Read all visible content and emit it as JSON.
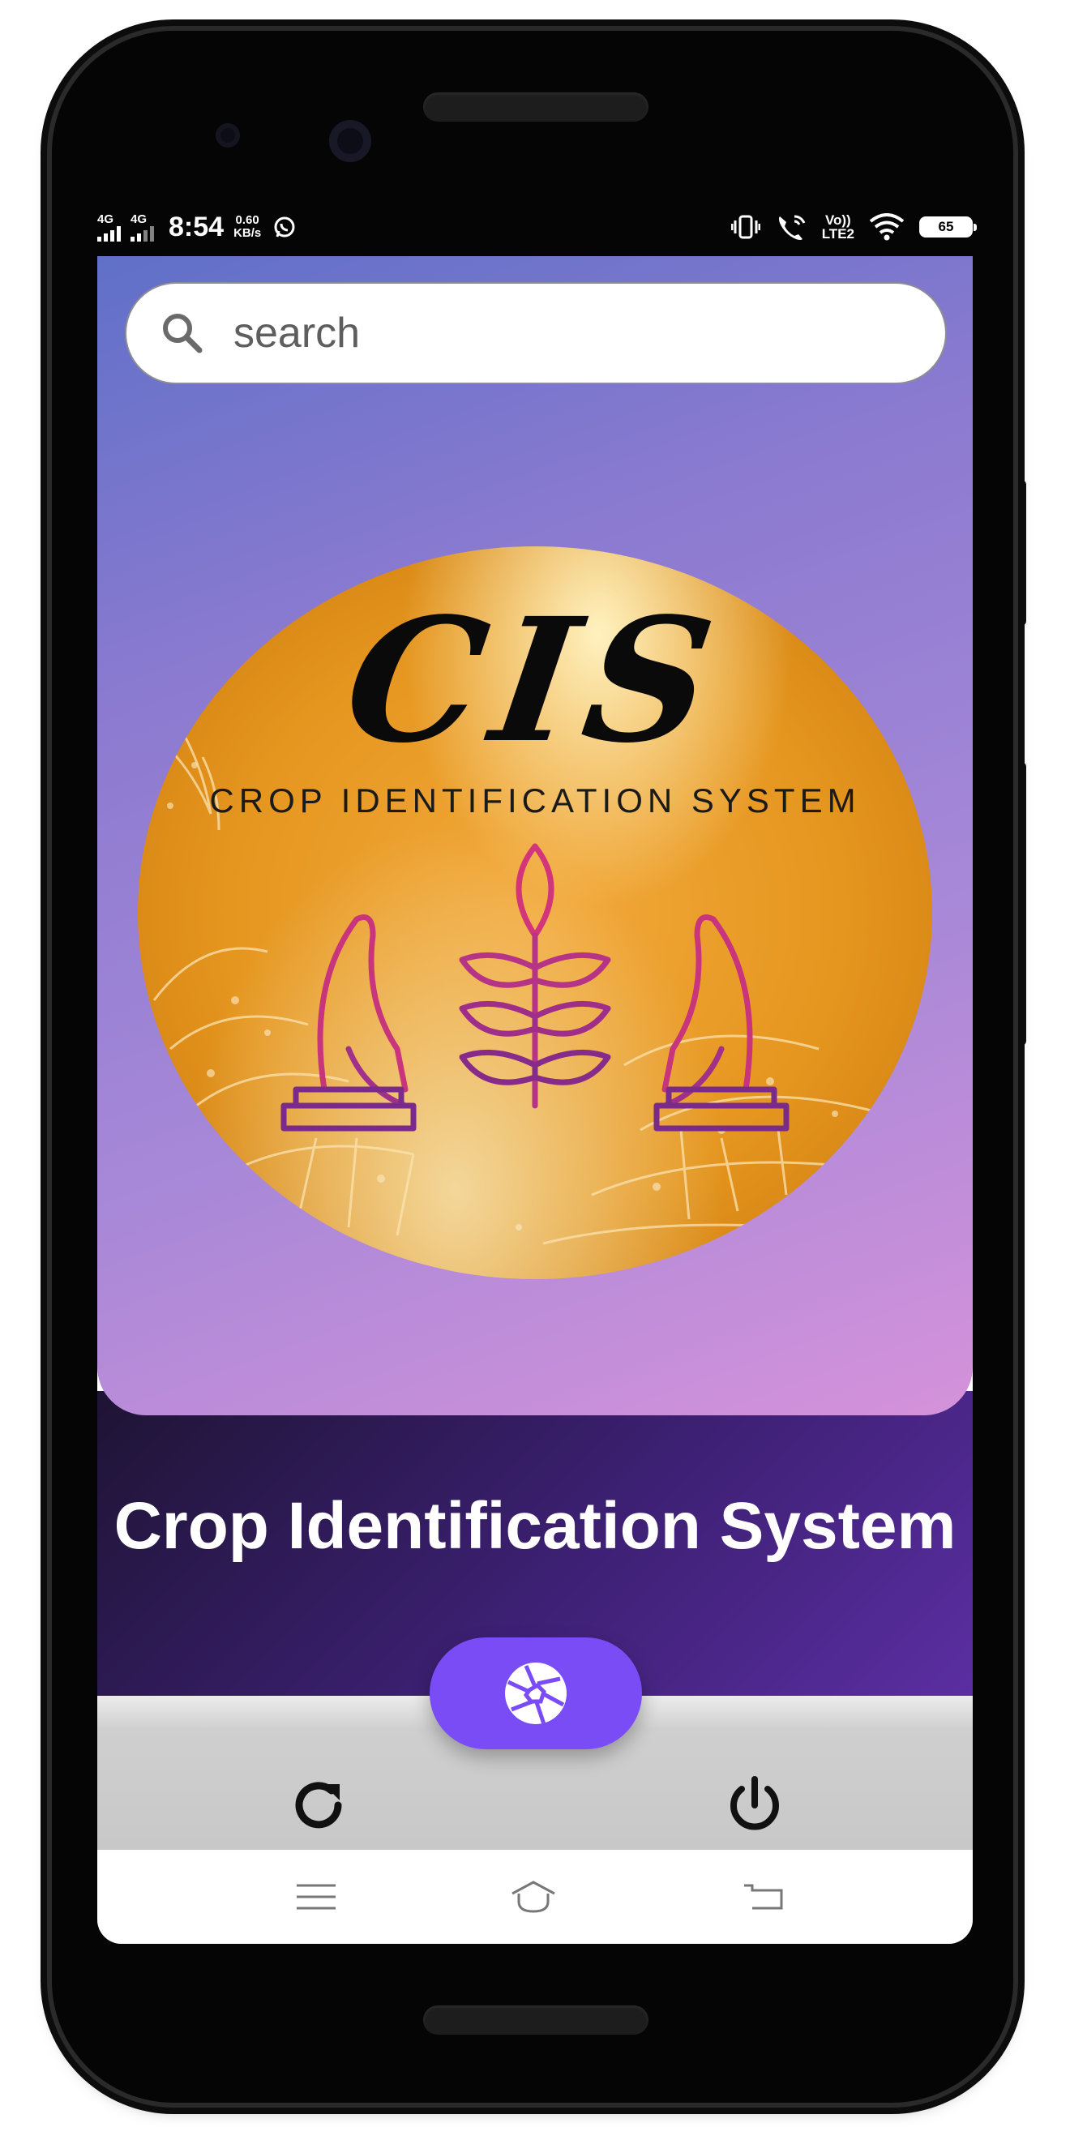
{
  "status_bar": {
    "network1": "4G",
    "network2": "4G",
    "time": "8:54",
    "speed_value": "0.60",
    "speed_unit": "KB/s",
    "volte_top": "Vo))",
    "volte_bottom": "LTE2",
    "battery": "65"
  },
  "search": {
    "placeholder": "search"
  },
  "logo": {
    "mark": "CIS",
    "subtitle": "CROP IDENTIFICATION SYSTEM"
  },
  "app_title": "Crop Identification System",
  "icons": {
    "search": "search-icon",
    "camera": "camera-aperture-icon",
    "refresh": "refresh-icon",
    "power": "power-icon",
    "nav_menu": "menu-icon",
    "nav_home": "home-icon",
    "nav_back": "back-icon"
  },
  "colors": {
    "fab": "#7a4cf5",
    "hero_gradient_start": "#6070c8",
    "hero_gradient_end": "#d592da",
    "footer_purple": "#3d2074"
  }
}
